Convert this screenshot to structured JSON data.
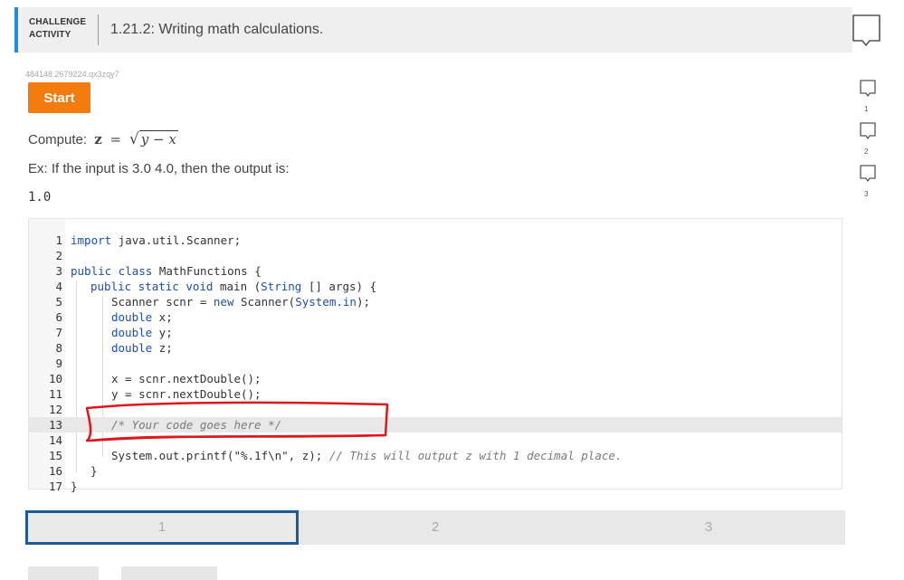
{
  "header": {
    "badge_line1": "CHALLENGE",
    "badge_line2": "ACTIVITY",
    "title": "1.21.2: Writing math calculations."
  },
  "seed_id": "484148.2679224.qx3zqy7",
  "start_label": "Start",
  "prompt": {
    "compute_label": "Compute:",
    "var_z": "z",
    "equals": "=",
    "radicand": "y − x",
    "example_text": "Ex: If the input is 3.0 4.0, then the output is:",
    "example_output": "1.0"
  },
  "code": {
    "line_numbers": [
      "1",
      "2",
      "3",
      "4",
      "5",
      "6",
      "7",
      "8",
      "9",
      "10",
      "11",
      "12",
      "13",
      "14",
      "15",
      "16",
      "17"
    ],
    "lines": {
      "l1_kw": "import",
      "l1_rest": " java.util.Scanner;",
      "l3_kw": "public class",
      "l3_rest": " MathFunctions {",
      "l4_kw": "public static void",
      "l4_mid": " main (",
      "l4_type": "String",
      "l4_rest": " [] args) {",
      "l5_a": "Scanner scnr = ",
      "l5_kw": "new",
      "l5_b": " Scanner(",
      "l5_type": "System.in",
      "l5_c": ");",
      "l6_kw": "double",
      "l6_rest": " x;",
      "l7_kw": "double",
      "l7_rest": " y;",
      "l8_kw": "double",
      "l8_rest": " z;",
      "l10": "x = scnr.nextDouble();",
      "l11": "y = scnr.nextDouble();",
      "l13_comment": "/* Your code goes here */",
      "l15_code": "System.out.printf(\"%.1f\\n\", z); ",
      "l15_comment": "// This will output z with 1 decimal place.",
      "l16": "}",
      "l17": "}"
    }
  },
  "steps": {
    "items": [
      "1",
      "2",
      "3"
    ],
    "current": "1"
  },
  "side_levels": [
    "1",
    "2",
    "3"
  ],
  "colors": {
    "accent_blue": "#1e8fdb",
    "start_orange": "#f47c0e",
    "annotation_red": "#e0161b",
    "step_border": "#1d5a97"
  }
}
